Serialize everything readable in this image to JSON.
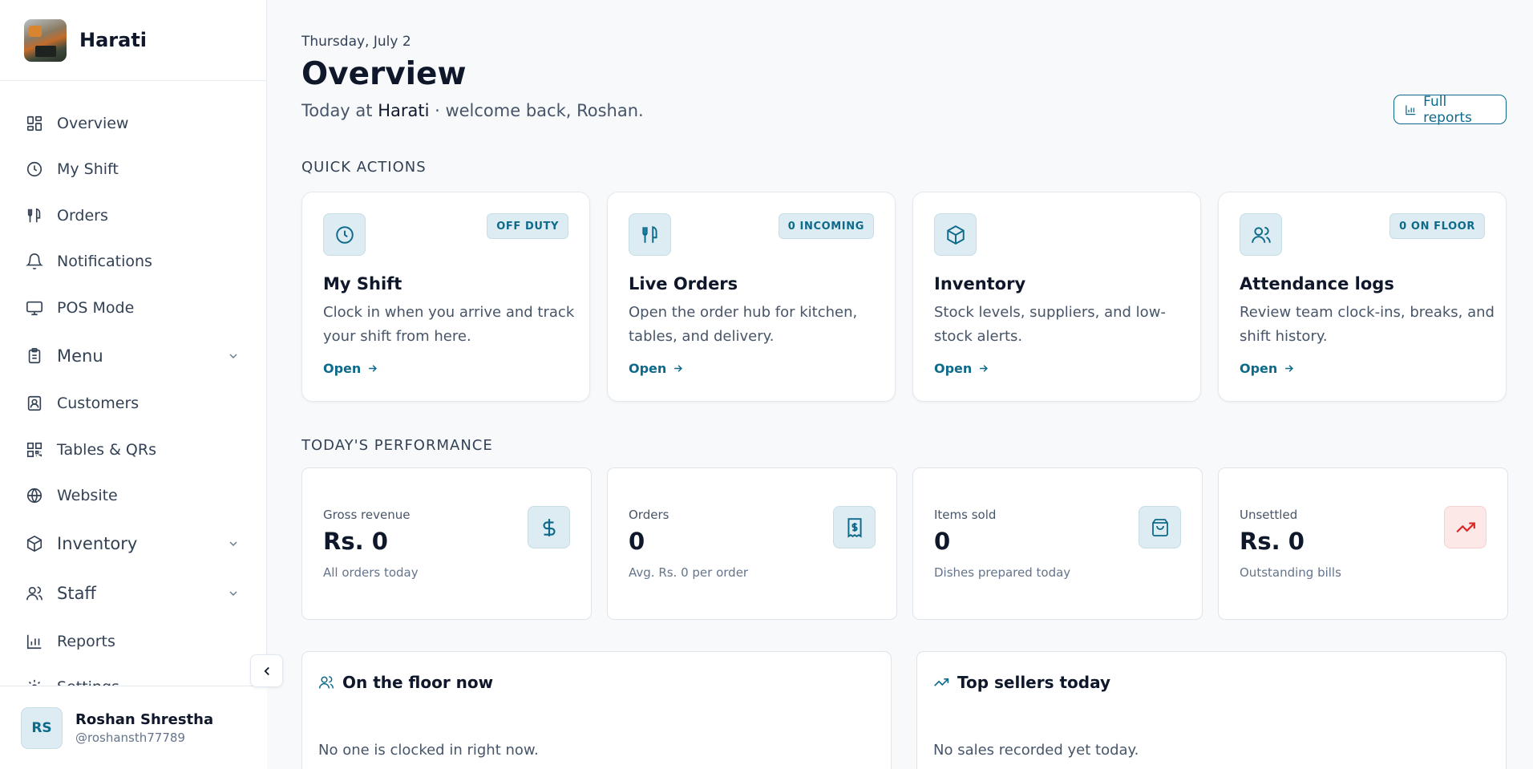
{
  "brand": {
    "name": "Harati"
  },
  "nav": {
    "items": [
      {
        "label": "Overview",
        "icon": "overview-icon"
      },
      {
        "label": "My Shift",
        "icon": "clock-icon"
      },
      {
        "label": "Orders",
        "icon": "utensils-icon"
      },
      {
        "label": "Notifications",
        "icon": "bell-icon"
      },
      {
        "label": "POS Mode",
        "icon": "monitor-icon"
      },
      {
        "label": "Menu",
        "icon": "clipboard-icon",
        "expandable": true
      },
      {
        "label": "Customers",
        "icon": "contact-icon"
      },
      {
        "label": "Tables & QRs",
        "icon": "qr-icon"
      },
      {
        "label": "Website",
        "icon": "globe-icon"
      },
      {
        "label": "Inventory",
        "icon": "package-icon",
        "expandable": true
      },
      {
        "label": "Staff",
        "icon": "users-icon",
        "expandable": true
      },
      {
        "label": "Reports",
        "icon": "bar-chart-icon"
      },
      {
        "label": "Settings",
        "icon": "gear-icon"
      }
    ]
  },
  "user": {
    "initials": "RS",
    "name": "Roshan Shrestha",
    "handle": "@roshansth77789"
  },
  "header": {
    "date": "Thursday, July 2",
    "title": "Overview",
    "welcome_prefix": "Today at ",
    "welcome_place": "Harati",
    "welcome_suffix": " · welcome back, Roshan.",
    "reports_button": "Full reports"
  },
  "quick_actions": {
    "label": "QUICK ACTIONS",
    "cards": [
      {
        "title": "My Shift",
        "badge": "OFF DUTY",
        "desc": "Clock in when you arrive and track your shift from here.",
        "open": "Open",
        "icon": "clock-icon"
      },
      {
        "title": "Live Orders",
        "badge": "0 INCOMING",
        "desc": "Open the order hub for kitchen, tables, and delivery.",
        "open": "Open",
        "icon": "utensils-icon"
      },
      {
        "title": "Inventory",
        "badge": "",
        "desc": "Stock levels, suppliers, and low-stock alerts.",
        "open": "Open",
        "icon": "package-icon"
      },
      {
        "title": "Attendance logs",
        "badge": "0 ON FLOOR",
        "desc": "Review team clock-ins, breaks, and shift history.",
        "open": "Open",
        "icon": "users-icon"
      }
    ]
  },
  "performance": {
    "label": "TODAY'S PERFORMANCE",
    "cards": [
      {
        "label": "Gross revenue",
        "value": "Rs. 0",
        "sub": "All orders today",
        "icon": "dollar-icon"
      },
      {
        "label": "Orders",
        "value": "0",
        "sub": "Avg. Rs. 0 per order",
        "icon": "receipt-icon"
      },
      {
        "label": "Items sold",
        "value": "0",
        "sub": "Dishes prepared today",
        "icon": "shopping-bag-icon"
      },
      {
        "label": "Unsettled",
        "value": "Rs. 0",
        "sub": "Outstanding bills",
        "icon": "trending-up-icon"
      }
    ]
  },
  "panels": {
    "floor": {
      "title": "On the floor now",
      "empty": "No one is clocked in right now."
    },
    "sellers": {
      "title": "Top sellers today",
      "empty": "No sales recorded yet today."
    }
  },
  "colors": {
    "accent": "#0e6a8a",
    "accent_bg": "#dcecf2",
    "danger": "#dc2626",
    "danger_bg": "#fde8e8"
  }
}
